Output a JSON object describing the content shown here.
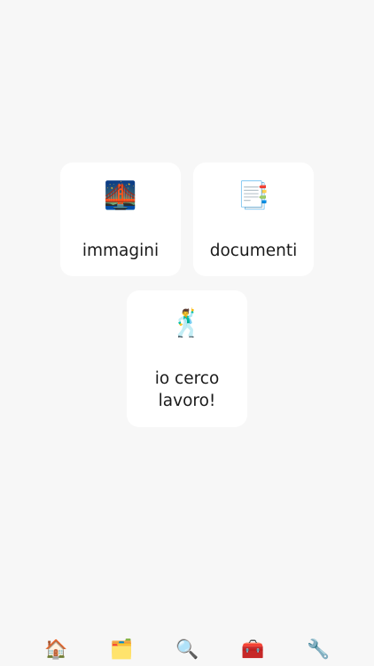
{
  "cards": [
    {
      "icon": "🌉",
      "icon_name": "bridge-at-night-icon",
      "label": "immagini"
    },
    {
      "icon": "📑",
      "icon_name": "bookmark-tabs-document-icon",
      "label": "documenti"
    },
    {
      "icon": "🕺",
      "icon_name": "dancing-man-icon",
      "label": "io cerco lavoro!"
    }
  ],
  "tabbar": [
    {
      "icon": "🏠",
      "icon_name": "house-icon"
    },
    {
      "icon": "🗂️",
      "icon_name": "folder-icon"
    },
    {
      "icon": "🔍",
      "icon_name": "magnifying-glass-icon"
    },
    {
      "icon": "🧰",
      "icon_name": "toolbox-icon"
    },
    {
      "icon": "🔧",
      "icon_name": "wrench-icon"
    }
  ],
  "colors": {
    "background": "#f7f7f7",
    "card": "#ffffff",
    "text": "#1a1a1a"
  }
}
